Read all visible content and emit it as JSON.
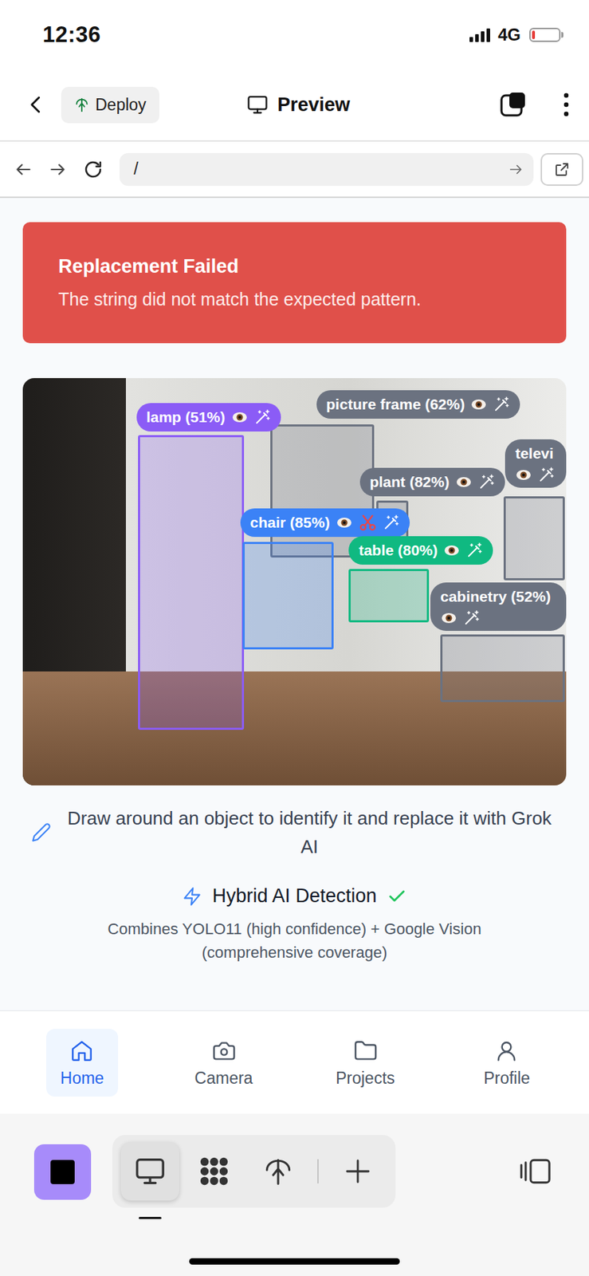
{
  "status_bar": {
    "time": "12:36",
    "network": "4G",
    "battery_level": 0.1
  },
  "toolbar": {
    "deploy_button": "Deploy",
    "title": "Preview"
  },
  "url_bar": {
    "path": "/"
  },
  "alert": {
    "title": "Replacement Failed",
    "message": "The string did not match the expected pattern."
  },
  "detections": [
    {
      "label": "lamp (51%)",
      "color": "#8b5cf6",
      "cuttable": false
    },
    {
      "label": "picture frame (62%)",
      "color": "#6b7280",
      "cuttable": false
    },
    {
      "label": "televi",
      "color": "#6b7280",
      "cuttable": false
    },
    {
      "label": "plant (82%)",
      "color": "#6b7280",
      "cuttable": false
    },
    {
      "label": "chair (85%)",
      "color": "#3b82f6",
      "cuttable": true
    },
    {
      "label": "table (80%)",
      "color": "#10b981",
      "cuttable": false
    },
    {
      "label": "cabinetry (52%)",
      "color": "#6b7280",
      "cuttable": false
    }
  ],
  "hint": "Draw around an object to identify it and replace it with Grok AI",
  "feature": {
    "title": "Hybrid AI Detection",
    "enabled": true,
    "description": "Combines YOLO11 (high confidence) + Google Vision (comprehensive coverage)"
  },
  "nav": [
    {
      "label": "Home",
      "selected": true
    },
    {
      "label": "Camera",
      "selected": false
    },
    {
      "label": "Projects",
      "selected": false
    },
    {
      "label": "Profile",
      "selected": false
    }
  ],
  "editor_bar": {
    "tools": [
      {
        "selected": true
      },
      {
        "selected": false
      },
      {
        "selected": false
      }
    ]
  }
}
